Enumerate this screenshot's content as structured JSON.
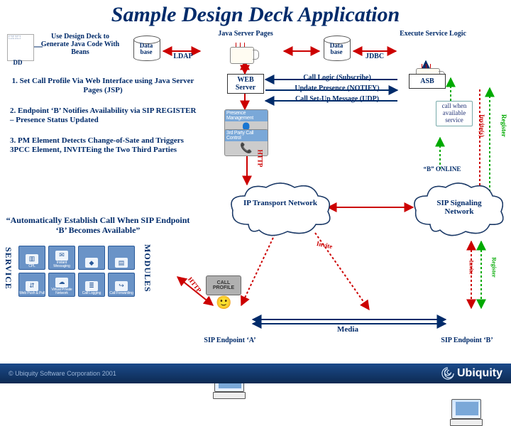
{
  "title": "Sample Design Deck Application",
  "top": {
    "dd": "DD",
    "dd_desc": "Use Design Deck to Generate Java Code With Beans",
    "db1": "Data base",
    "ldap": "LDAP",
    "jsp": "Java Server Pages",
    "db2": "Data base",
    "jdbc": "JDBC",
    "esl": "Execute Service Logic",
    "web": "WEB Server",
    "asb": "ASB",
    "cl": "Call Logic (Subscribe)",
    "up": "Update Presence (NOTIFY)",
    "cs": "Call Set-Up Message (UDP)"
  },
  "steps": {
    "s1": "1. Set Call Profile Via Web Interface using Java Server Pages (JSP)",
    "s2": "2. Endpoint ‘B’ Notifies Availability via SIP REGISTER – Presence Status Updated",
    "s3": "3. PM Element Detects Change-of-Sate and Triggers 3PCC Element, INVITEing the Two Third Parties"
  },
  "quote": "“Automatically Establish Call When SIP Endpoint ‘B’ Becomes Available”",
  "left_v": "SERVICE",
  "right_v": "MODULES",
  "svc": {
    "m0": "CPL",
    "m1": "Instant Messaging",
    "m2": "",
    "m3": "",
    "m4": "Web Push & Pull",
    "m5": "Virtual Private Network",
    "m6": "Call Logging",
    "m7": "Call Forwarding"
  },
  "panels": {
    "pm": "Presence Management",
    "tpc": "3rd Party Call Control"
  },
  "mid": {
    "http": "HTTP",
    "http2": "HTTP",
    "ipt": "IP Transport Network",
    "callp": "CALL PROFILE",
    "sea": "SIP Endpoint ‘A’",
    "media": "Media",
    "invite": "Invite"
  },
  "right": {
    "cwa": "call when available service",
    "bon": "“B” ONLINE",
    "ssn": "SIP Signaling Network",
    "seb": "SIP Endpoint ‘B’",
    "reg": "Register",
    "inv": "Invite(s)",
    "reg2": "Register",
    "inv2": "Invite"
  },
  "footer": {
    "copy": "© Ubiquity Software Corporation 2001",
    "brand": "Ubiquity"
  }
}
